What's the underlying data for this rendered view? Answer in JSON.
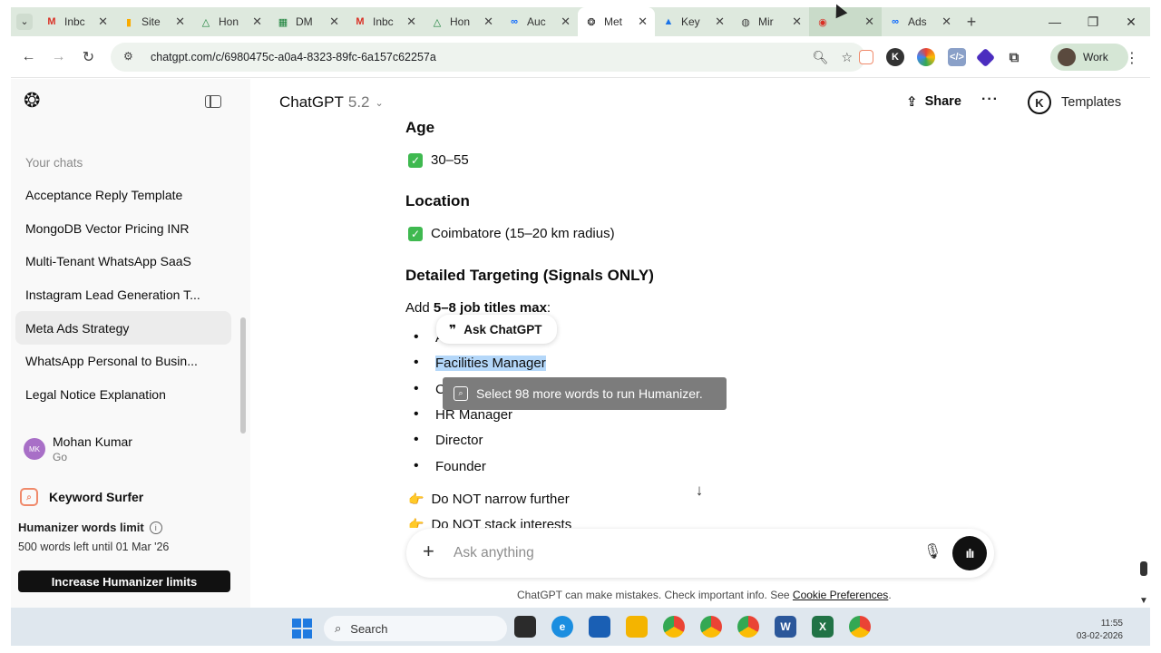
{
  "browser": {
    "tabs": [
      {
        "label": "Inbc",
        "icon": "gmail-icon",
        "color": "#d93025"
      },
      {
        "label": "Site",
        "icon": "analytics-icon",
        "color": "#f9ab00"
      },
      {
        "label": "Hon",
        "icon": "drive-icon",
        "color": "#188038"
      },
      {
        "label": "DM",
        "icon": "sheets-icon",
        "color": "#188038"
      },
      {
        "label": "Inbc",
        "icon": "gmail-icon",
        "color": "#d93025"
      },
      {
        "label": "Hon",
        "icon": "drive-icon",
        "color": "#188038"
      },
      {
        "label": "Auc",
        "icon": "meta-icon",
        "color": "#0866ff"
      },
      {
        "label": "Met",
        "icon": "chatgpt-icon",
        "color": "#111111",
        "active": true
      },
      {
        "label": "Key",
        "icon": "ads-icon",
        "color": "#1a73e8"
      },
      {
        "label": "Mir",
        "icon": "globe-icon",
        "color": "#444444"
      },
      {
        "label": "",
        "icon": "record-icon",
        "color": "#d93025"
      },
      {
        "label": "Ads",
        "icon": "meta-icon",
        "color": "#0866ff"
      }
    ],
    "url": "chatgpt.com/c/6980475c-a0a4-8323-89fc-6a157c62257a",
    "profile_label": "Work"
  },
  "sidebar": {
    "section_title": "Your chats",
    "chats": [
      {
        "label": "Acceptance Reply Template"
      },
      {
        "label": "MongoDB Vector Pricing INR"
      },
      {
        "label": "Multi-Tenant WhatsApp SaaS"
      },
      {
        "label": "Instagram Lead Generation T..."
      },
      {
        "label": "Meta Ads Strategy",
        "active": true
      },
      {
        "label": "WhatsApp Personal to Busin..."
      },
      {
        "label": "Legal Notice Explanation"
      }
    ],
    "user": {
      "name": "Mohan Kumar",
      "plan": "Go",
      "initials": "MK"
    },
    "keyword_surfer": "Keyword Surfer",
    "humanizer": {
      "title": "Humanizer words limit",
      "remaining": "500 words left until 01 Mar '26",
      "button": "Increase Humanizer limits"
    }
  },
  "header": {
    "model": "ChatGPT",
    "version": "5.2",
    "share": "Share",
    "templates": "Templates",
    "templates_icon_letter": "K"
  },
  "content": {
    "age_heading": "Age",
    "age_value": "30–55",
    "location_heading": "Location",
    "location_value": "Coimbatore (15–20 km radius)",
    "targeting_heading": "Detailed Targeting (Signals ONLY)",
    "add_prefix": "Add ",
    "add_bold": "5–8 job titles max",
    "add_suffix": ":",
    "bullets": {
      "b1": "A",
      "b2": "Facilities Manager",
      "b3": "C",
      "b4": "HR Manager",
      "b5": "Director",
      "b6": "Founder"
    },
    "note1": "Do NOT narrow further",
    "note2": "Do NOT stack interests"
  },
  "tooltips": {
    "ask": "Ask ChatGPT",
    "humanizer": "Select 98 more words to run Humanizer."
  },
  "composer": {
    "placeholder": "Ask anything"
  },
  "footer": {
    "disclaimer": "ChatGPT can make mistakes. Check important info. See ",
    "link": "Cookie Preferences",
    "end": "."
  },
  "taskbar": {
    "search": "Search",
    "time": "11:55",
    "date": "03-02-2026"
  }
}
